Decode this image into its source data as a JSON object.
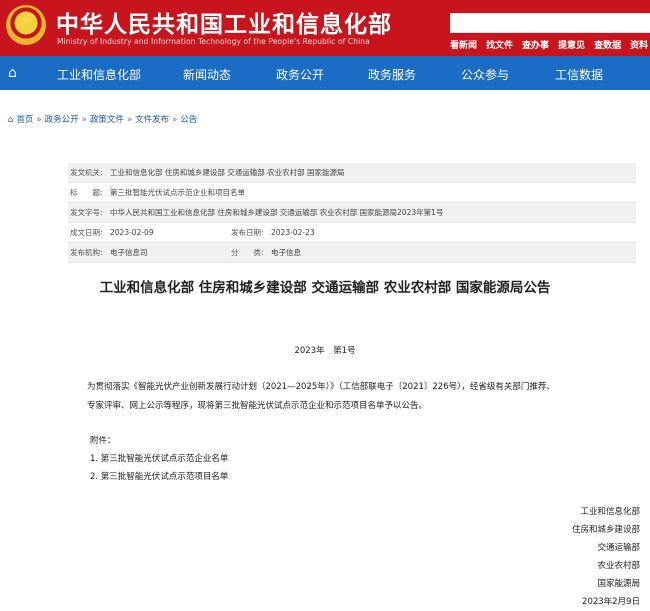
{
  "header": {
    "site_title": "中华人民共和国工业和信息化部",
    "site_subtitle": "Ministry of Industry and Information Technology of the People's Republic of China",
    "top_links": [
      "看新闻",
      "找文件",
      "查办事",
      "提意见",
      "查数据",
      "资料"
    ]
  },
  "nav": {
    "items": [
      "工业和信息化部",
      "新闻动态",
      "政务公开",
      "政务服务",
      "公众参与",
      "工信数据"
    ]
  },
  "breadcrumb": {
    "items": [
      "首页",
      "政务公开",
      "政策文件",
      "文件发布",
      "公告"
    ]
  },
  "meta": {
    "issuer_label": "发文机关:",
    "issuer": "工业和信息化部 住房和城乡建设部 交通运输部 农业农村部 国家能源局",
    "subject_label": "标　　题:",
    "subject": "第三批智能光伏试点示范企业和项目名单",
    "doc_no_label": "发文字号:",
    "doc_no": "中华人民共和国工业和信息化部 住房和城乡建设部 交通运输部 农业农村部 国家能源局2023年第1号",
    "created_label": "成文日期:",
    "created": "2023-02-09",
    "published_label": "发布日期:",
    "published": "2023-02-23",
    "agency_label": "发布机构:",
    "agency": "电子信息司",
    "category_label": "分　　类:",
    "category": "电子信息"
  },
  "article": {
    "title": "工业和信息化部 住房和城乡建设部 交通运输部 农业农村部 国家能源局公告",
    "number": "2023年　第1号",
    "paragraph": "为贯彻落实《智能光伏产业创新发展行动计划（2021—2025年）》（工信部联电子〔2021〕226号），经省级有关部门推荐、专家评审、网上公示等程序，现将第三批智能光伏试点示范企业和示范项目名单予以公告。",
    "attachments_label": "附件：",
    "attachments": [
      "1. 第三批智能光伏试点示范企业名单",
      "2. 第三批智能光伏试点示范项目名单"
    ],
    "signers": [
      "工业和信息化部",
      "住房和城乡建设部",
      "交通运输部",
      "农业农村部",
      "国家能源局",
      "2023年2月9日"
    ]
  }
}
